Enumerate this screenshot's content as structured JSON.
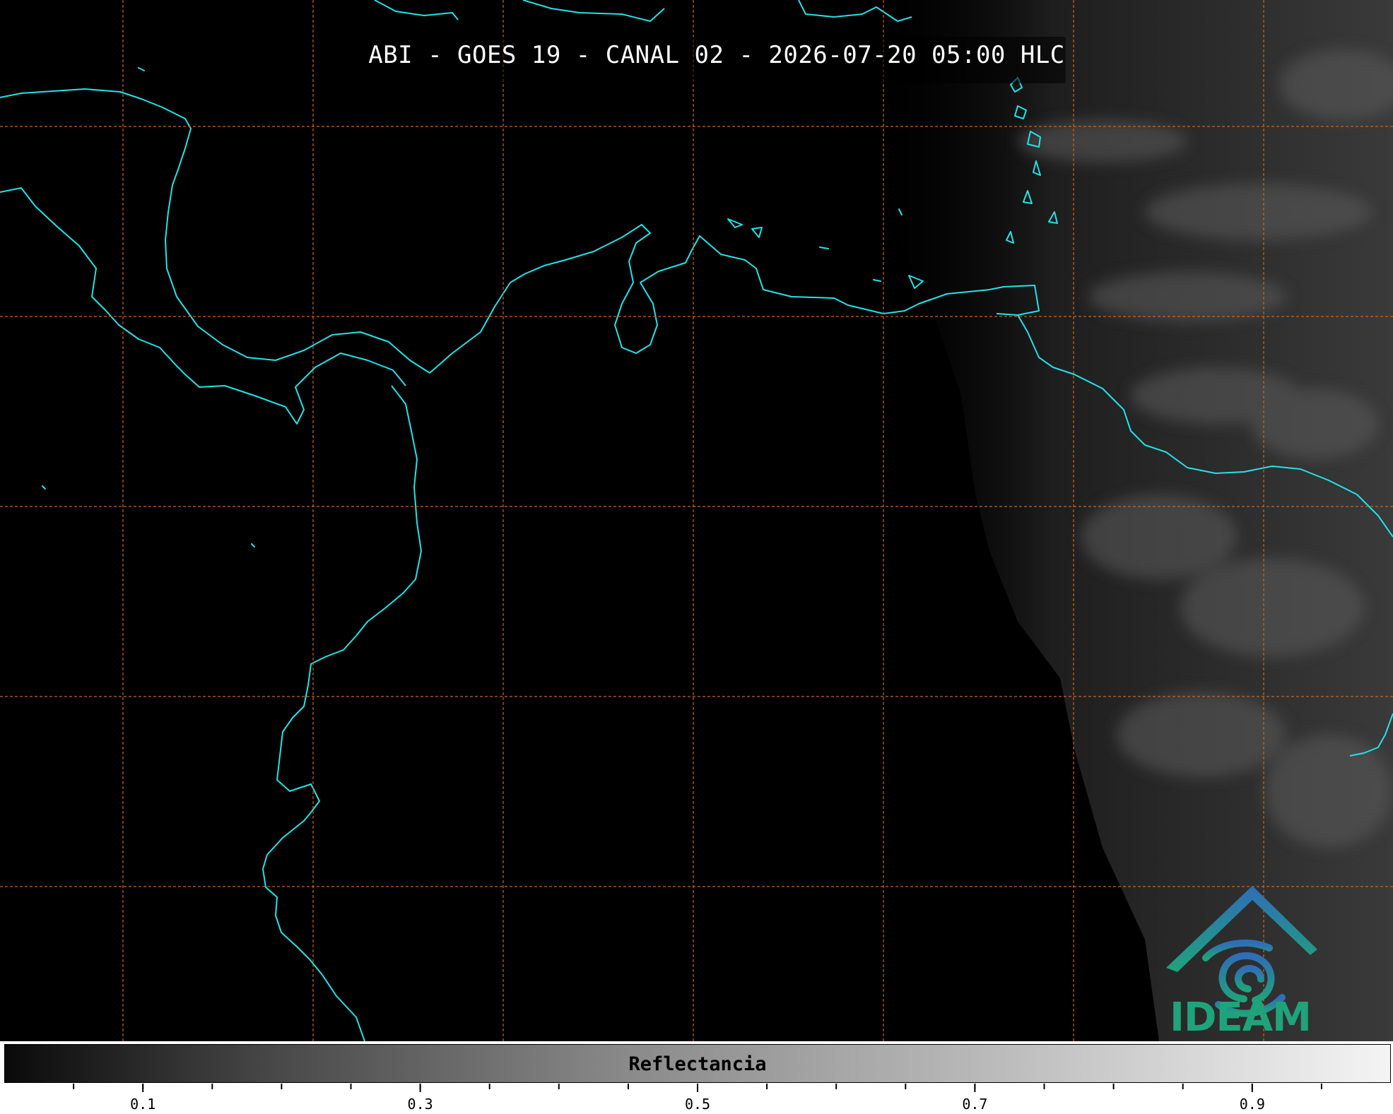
{
  "title": "ABI - GOES 19 - CANAL 02 - 2026-07-20 05:00 HLC",
  "colors": {
    "coastline": "#22e3e8",
    "gridline": "#c8661c",
    "background": "#000000",
    "logo_top": "#2f6db8",
    "logo_bottom": "#1fa37a"
  },
  "logo": {
    "name": "IDEAM",
    "text": "IDEAM"
  },
  "colorbar": {
    "label": "Reflectancia",
    "range": [
      0.0,
      1.0
    ],
    "tick_labels": [
      "0.1",
      "0.3",
      "0.5",
      "0.7",
      "0.9"
    ],
    "tick_values": [
      0.1,
      0.3,
      0.5,
      0.7,
      0.9
    ],
    "minor_tick_step": 0.05
  }
}
